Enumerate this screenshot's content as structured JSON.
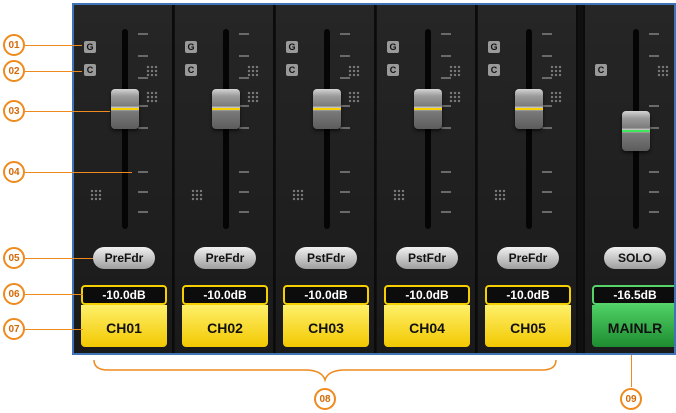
{
  "callouts": [
    "01",
    "02",
    "03",
    "04",
    "05",
    "06",
    "07",
    "08",
    "09"
  ],
  "group_labels": {
    "g": "G",
    "c": "C"
  },
  "channels": [
    {
      "send_mode": "PreFdr",
      "level": "-10.0dB",
      "name": "CH01"
    },
    {
      "send_mode": "PreFdr",
      "level": "-10.0dB",
      "name": "CH02"
    },
    {
      "send_mode": "PstFdr",
      "level": "-10.0dB",
      "name": "CH03"
    },
    {
      "send_mode": "PstFdr",
      "level": "-10.0dB",
      "name": "CH04"
    },
    {
      "send_mode": "PreFdr",
      "level": "-10.0dB",
      "name": "CH05"
    }
  ],
  "main": {
    "button": "SOLO",
    "level": "-16.5dB",
    "name": "MAINLR"
  },
  "colors": {
    "channel_accent": "#f5cf00",
    "main_accent": "#28a83c",
    "callout": "#ee8a1e",
    "frame": "#3f74b6"
  }
}
